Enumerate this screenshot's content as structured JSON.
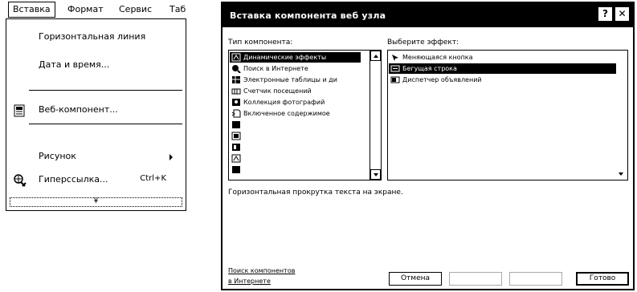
{
  "menubar": {
    "items": [
      "Вставка",
      "Формат",
      "Сервис",
      "Таб"
    ]
  },
  "menu": {
    "items": [
      {
        "label": "Горизонтальная линия",
        "icon": "none"
      },
      {
        "label": "Дата и время...",
        "icon": "none"
      },
      {
        "label": "Веб-компонент...",
        "icon": "web-component-icon"
      },
      {
        "label": "Рисунок",
        "icon": "none",
        "submenu": true
      },
      {
        "label": "Гиперссылка...",
        "icon": "hyperlink-icon",
        "shortcut": "Ctrl+K"
      }
    ],
    "more": "¥"
  },
  "dialog": {
    "title": "Вставка компонента веб узла",
    "help": "?",
    "close": "✕",
    "type_label": "Тип компонента:",
    "effect_label": "Выберите эффект:",
    "types": [
      {
        "label": "Динамические эффекты",
        "selected": true
      },
      {
        "label": "Поиск в Интернете"
      },
      {
        "label": "Электронные таблицы и ди"
      },
      {
        "label": "Счетчик посещений"
      },
      {
        "label": "Коллекция фотографий"
      },
      {
        "label": "Включенное содержимое"
      },
      {
        "label": "",
        "faded": true
      },
      {
        "label": "",
        "faded": true
      },
      {
        "label": "",
        "faded": true
      },
      {
        "label": "",
        "faded": true
      },
      {
        "label": "",
        "faded": true
      }
    ],
    "effects": [
      {
        "label": "Меняющаяся кнопка"
      },
      {
        "label": "Бегущая строка",
        "selected": true
      },
      {
        "label": "Диспетчер объявлений"
      }
    ],
    "description": "Горизонтальная прокрутка текста на экране.",
    "search_link": [
      "Поиск компонентов",
      "в Интернете"
    ],
    "buttons": {
      "cancel": "Отмена",
      "back": "",
      "next": "",
      "finish": "Готово"
    }
  }
}
